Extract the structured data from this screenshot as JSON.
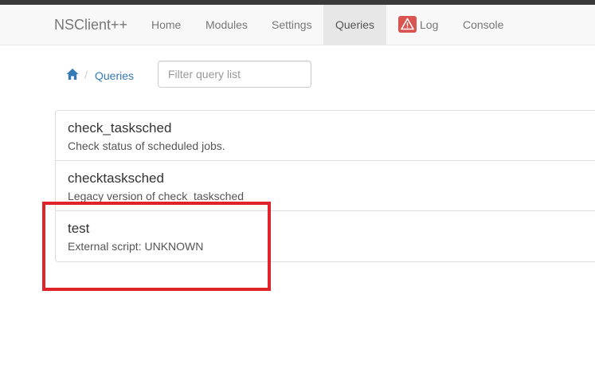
{
  "navbar": {
    "brand": "NSClient++",
    "items": [
      {
        "label": "Home"
      },
      {
        "label": "Modules"
      },
      {
        "label": "Settings"
      },
      {
        "label": "Queries"
      },
      {
        "label": "Log"
      },
      {
        "label": "Console"
      }
    ],
    "active": "Queries",
    "log_icon": "warning-icon",
    "log_icon_color": "#d9534f"
  },
  "breadcrumb": {
    "home_icon": "home-icon",
    "separator": "/",
    "current": "Queries"
  },
  "filter": {
    "placeholder": "Filter query list",
    "value": ""
  },
  "queries": [
    {
      "name": "check_tasksched",
      "description": "Check status of scheduled jobs."
    },
    {
      "name": "checktasksched",
      "description": "Legacy version of check_tasksched"
    },
    {
      "name": "test",
      "description": "External script: UNKNOWN"
    }
  ],
  "annotation": {
    "highlight_color": "#e0222b"
  }
}
